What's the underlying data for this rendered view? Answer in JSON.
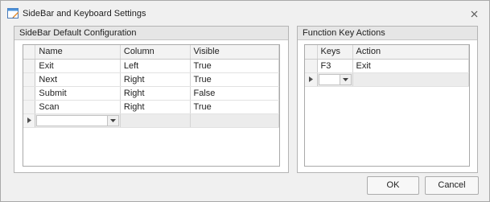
{
  "window": {
    "title": "SideBar and Keyboard Settings",
    "app_icon": "settings-window-icon",
    "close_icon": "close-icon"
  },
  "sidebar_group": {
    "title": "SideBar Default Configuration",
    "columns": [
      "Name",
      "Column",
      "Visible"
    ],
    "rows": [
      {
        "name": "Exit",
        "column": "Left",
        "visible": "True"
      },
      {
        "name": "Next",
        "column": "Right",
        "visible": "True"
      },
      {
        "name": "Submit",
        "column": "Right",
        "visible": "False"
      },
      {
        "name": "Scan",
        "column": "Right",
        "visible": "True"
      }
    ]
  },
  "function_group": {
    "title": "Function Key Actions",
    "columns": [
      "Keys",
      "Action"
    ],
    "rows": [
      {
        "keys": "F3",
        "action": "Exit"
      }
    ]
  },
  "buttons": {
    "ok": "OK",
    "cancel": "Cancel"
  },
  "icons": {
    "row_indicator": "new-row-arrow-icon",
    "dropdown": "chevron-down-icon"
  }
}
